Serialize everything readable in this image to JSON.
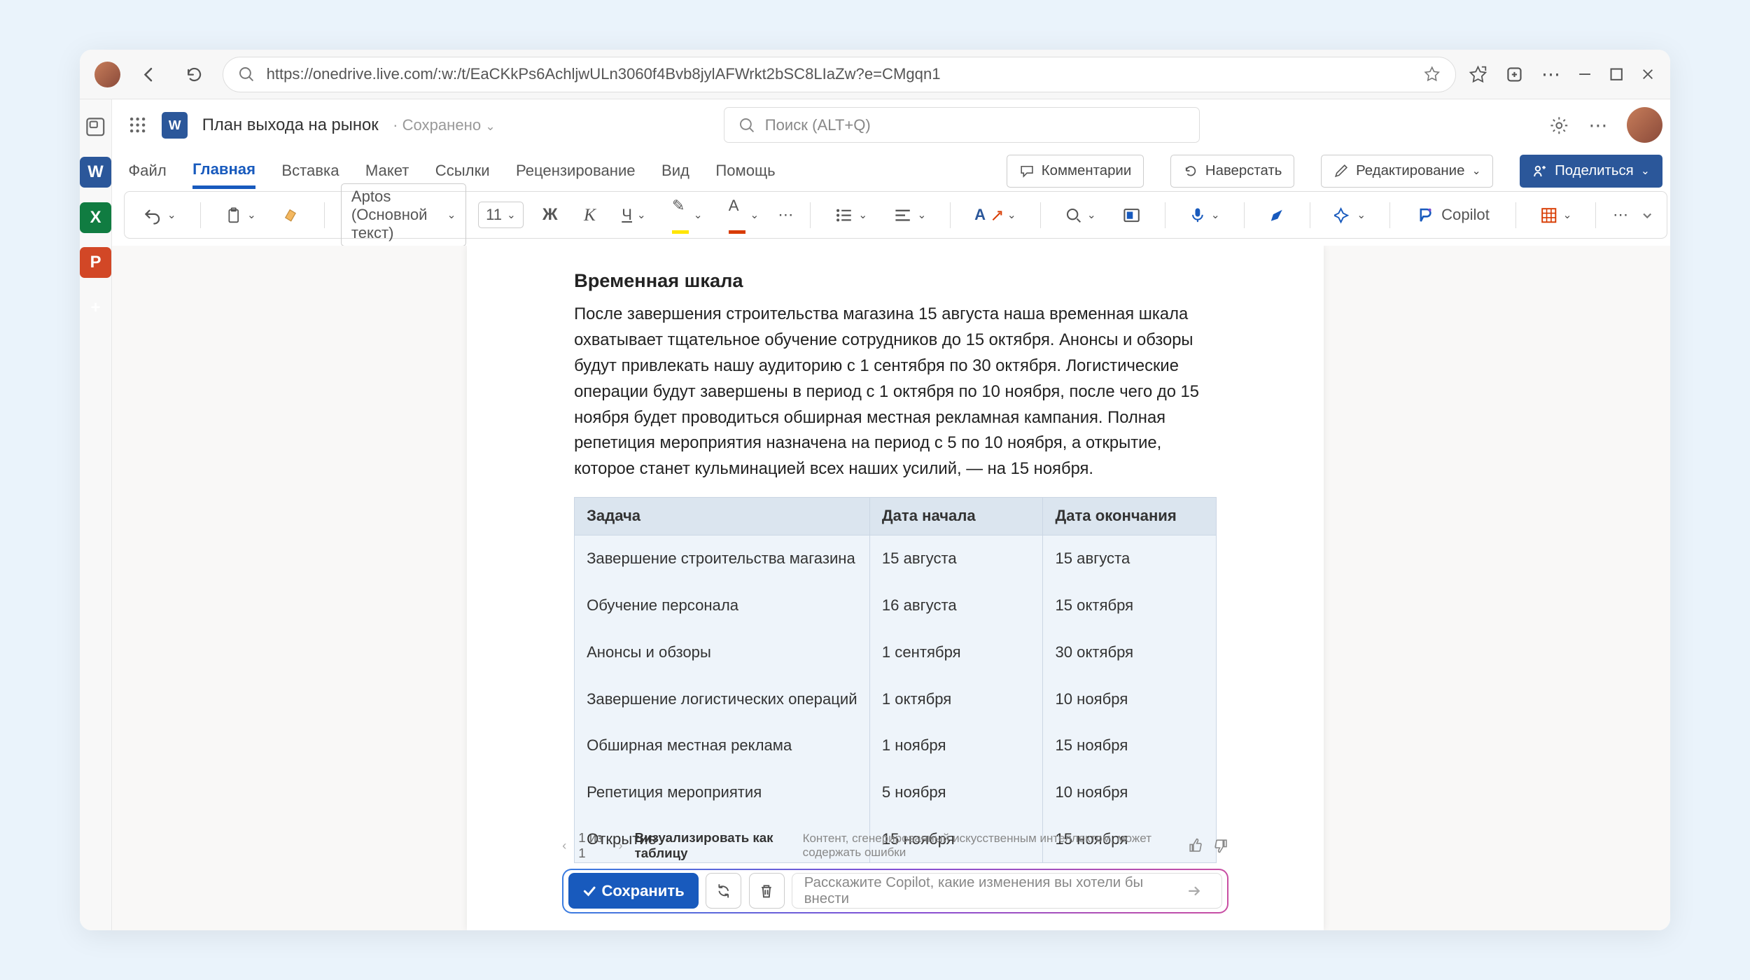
{
  "browser": {
    "url": "https://onedrive.live.com/:w:/t/EaCKkPs6AchljwULn3060f4Bvb8jylAFWrkt2bSC8LIaZw?e=CMgqn1"
  },
  "header": {
    "doc_title": "План выхода на рынок",
    "saved_label": "Сохранено",
    "search_placeholder": "Поиск (ALT+Q)"
  },
  "ribbon": {
    "tabs": {
      "file": "Файл",
      "home": "Главная",
      "insert": "Вставка",
      "layout": "Макет",
      "references": "Ссылки",
      "review": "Рецензирование",
      "view": "Вид",
      "help": "Помощь"
    },
    "buttons": {
      "comments": "Комментарии",
      "catchup": "Наверстать",
      "editing": "Редактирование",
      "share": "Поделиться"
    }
  },
  "toolbar": {
    "font": "Aptos (Основной текст)",
    "size": "11",
    "bold": "Ж",
    "italic": "К",
    "underline": "Ч",
    "styles_letter": "A",
    "copilot_label": "Copilot"
  },
  "document": {
    "heading": "Временная шкала",
    "paragraph": "После завершения строительства магазина 15 августа наша временная шкала охватывает тщательное обучение сотрудников до 15 октября. Анонсы и обзоры будут привлекать нашу аудиторию с 1 сентября по 30 октября. Логистические операции будут завершены в период с 1 октября по 10 ноября, после чего до 15 ноября будет проводиться обширная местная рекламная кампания. Полная репетиция мероприятия назначена на период с 5 по 10 ноября, а открытие, которое станет кульминацией всех наших усилий, — на 15 ноября.",
    "table": {
      "headers": {
        "task": "Задача",
        "start": "Дата начала",
        "end": "Дата окончания"
      },
      "rows": [
        {
          "task": "Завершение строительства магазина",
          "start": "15 августа",
          "end": "15 августа"
        },
        {
          "task": "Обучение персонала",
          "start": "16 августа",
          "end": "15 октября"
        },
        {
          "task": "Анонсы и обзоры",
          "start": "1 сентября",
          "end": "30 октября"
        },
        {
          "task": "Завершение логистических операций",
          "start": "1 октября",
          "end": "10 ноября"
        },
        {
          "task": "Обширная местная реклама",
          "start": "1 ноября",
          "end": "15 ноября"
        },
        {
          "task": "Репетиция мероприятия",
          "start": "5 ноября",
          "end": "10 ноября"
        },
        {
          "task": "Открытие",
          "start": "15 ноября",
          "end": "15 ноября"
        }
      ]
    }
  },
  "copilot_footer": {
    "pager": "1 из 1",
    "viz_label": "Визуализировать как таблицу",
    "disclaimer": "Контент, сгенерированный искусственным интеллектом, может содержать ошибки",
    "keep_label": "Сохранить",
    "prompt_placeholder": "Расскажите Copilot, какие изменения вы хотели бы внести"
  }
}
